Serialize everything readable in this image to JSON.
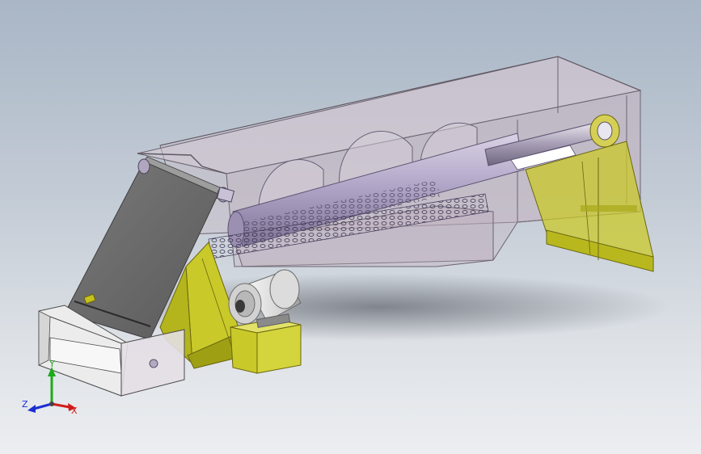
{
  "viewport": {
    "background_top": "#a9b6c6",
    "background_bottom": "#eceef1"
  },
  "model": {
    "colors": {
      "housing_fill": "#c8b8c4",
      "housing_edge": "#6d6470",
      "support_yellow": "#c9c92a",
      "support_dark": "#8d8d14",
      "screw_tube": "#b3a7c9",
      "screen_dark": "#6f6f6f",
      "motor_grey": "#e4e4e4"
    }
  },
  "triad": {
    "x_label": "X",
    "y_label": "Y",
    "z_label": "Z",
    "x_color": "#d11b1b",
    "y_color": "#1eaa1e",
    "z_color": "#1b2fd1"
  }
}
